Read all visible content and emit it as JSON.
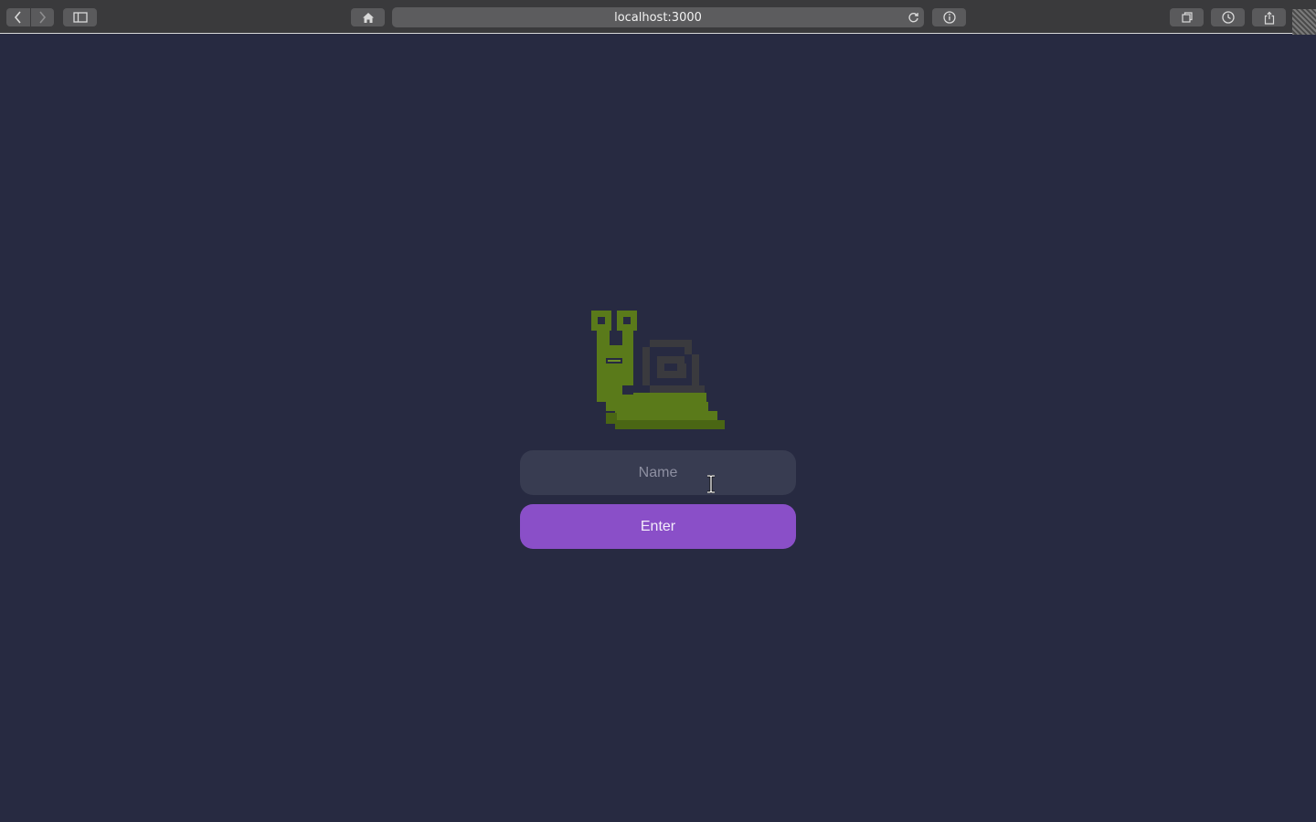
{
  "browser": {
    "url": "localhost:3000",
    "icons": {
      "back": "chevron-left-icon",
      "forward": "chevron-right-icon",
      "sidebar": "sidebar-icon",
      "home": "home-icon",
      "reload": "reload-icon",
      "info": "info-icon",
      "tabs": "tab-overview-icon",
      "history": "history-icon",
      "share": "share-icon"
    }
  },
  "page": {
    "background_color": "#272a41",
    "logo": "snail-logo",
    "name_input": {
      "placeholder": "Name",
      "value": ""
    },
    "enter_button": {
      "label": "Enter",
      "color": "#8a4fc8"
    }
  }
}
